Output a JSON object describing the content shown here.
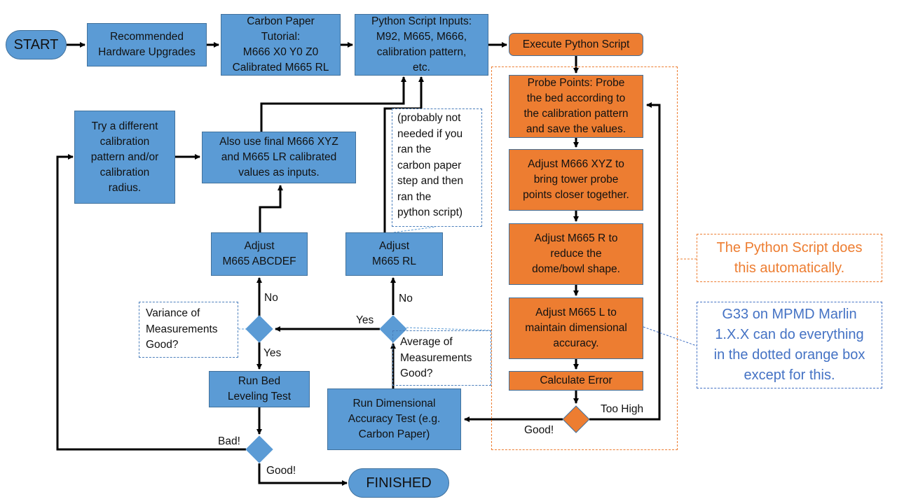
{
  "colors": {
    "process_blue": "#5b9bd5",
    "process_orange": "#ed7d31",
    "note_orange_text": "#ed7d31",
    "note_blue_text": "#4472c4",
    "connector": "#000000"
  },
  "nodes": {
    "start": "START",
    "hardware": "Recommended\nHardware Upgrades",
    "carbon_paper": "Carbon Paper\nTutorial:\nM666 X0 Y0 Z0\nCalibrated M665 RL",
    "python_inputs": "Python Script Inputs:\nM92, M665, M666,\ncalibration pattern,\netc.",
    "execute_script": "Execute Python Script",
    "probe_points": "Probe Points: Probe\nthe bed according to\nthe calibration pattern\nand save the values.",
    "adjust_m666": "Adjust M666 XYZ to\nbring tower probe\npoints closer together.",
    "adjust_m665_r": "Adjust M665 R to\nreduce the\ndome/bowl shape.",
    "adjust_m665_l": "Adjust M665 L to\nmaintain dimensional\naccuracy.",
    "calculate_error": "Calculate Error",
    "try_different": "Try a different\ncalibration\npattern and/or\ncalibration\nradius.",
    "also_use_final": "Also use final M666 XYZ\nand M665 LR calibrated\nvalues as inputs.",
    "adjust_abcdef": "Adjust\nM665 ABCDEF",
    "adjust_rl": "Adjust\nM665 RL",
    "run_bed_leveling": "Run Bed\nLeveling Test",
    "run_dimensional": "Run Dimensional\nAccuracy Test (e.g.\nCarbon Paper)",
    "finished": "FINISHED"
  },
  "notes": {
    "probably_not_needed": "(probably not\nneeded if you\nran the\ncarbon paper\nstep and then\nran the\npython script)",
    "variance_question": "Variance of\nMeasurements\nGood?",
    "average_question": "Average of\nMeasurements\nGood?",
    "python_auto": "The Python Script does\nthis automatically.",
    "g33_note": "G33 on MPMD Marlin\n1.X.X can do everything\nin the dotted orange box\nexcept for this."
  },
  "edge_labels": {
    "too_high": "Too High",
    "good_error": "Good!",
    "no_abcdef": "No",
    "no_rl": "No",
    "yes_average": "Yes",
    "yes_variance": "Yes",
    "bad": "Bad!",
    "good_final": "Good!"
  }
}
